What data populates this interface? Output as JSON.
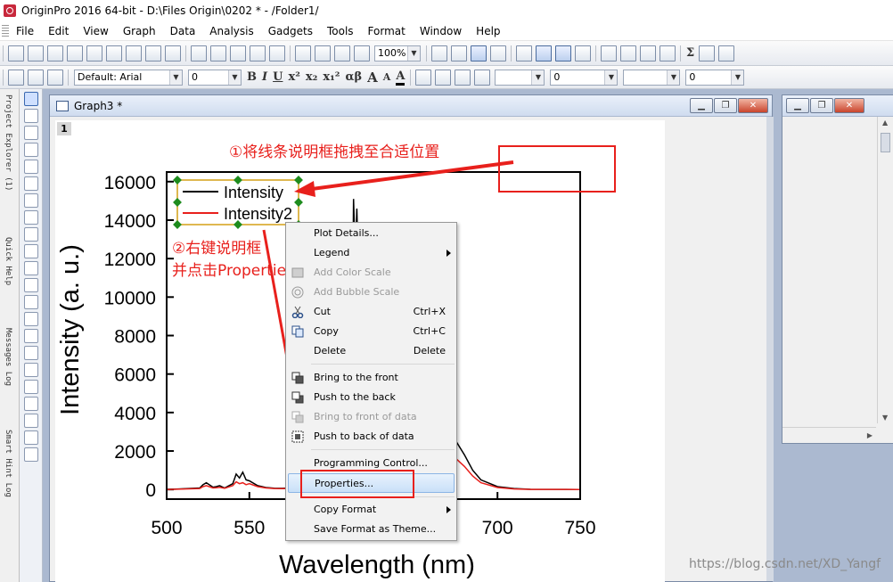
{
  "app": {
    "title": "OriginPro 2016 64-bit - D:\\Files Origin\\0202 * - /Folder1/"
  },
  "menu": {
    "items": [
      "File",
      "Edit",
      "View",
      "Graph",
      "Data",
      "Analysis",
      "Gadgets",
      "Tools",
      "Format",
      "Window",
      "Help"
    ]
  },
  "toolbar": {
    "zoom_value": "100%",
    "font_name": "Default: Arial",
    "font_size": "0",
    "line_width": "0",
    "fill_value": "0",
    "bold_label": "B",
    "italic_label": "I",
    "underline_label": "U",
    "superscript_label": "x²",
    "subscript_label": "x₂",
    "supsub_label": "x₁²",
    "greek_label": "αβ",
    "increase_font_label": "A",
    "decrease_font_label": "A",
    "font_color_label": "A",
    "sum_label": "Σ",
    "grip_label": "⋮"
  },
  "sidebar": {
    "tabs": [
      "Project Explorer (1)",
      "Quick Help",
      "Messages Log",
      "Smart Hint Log"
    ]
  },
  "graph_window": {
    "title": "Graph3 *",
    "layer_number": "1"
  },
  "chart_data": {
    "type": "line",
    "xlabel": "Wavelength (nm)",
    "ylabel": "Intensity (a. u.)",
    "xlim": [
      500,
      750
    ],
    "ylim": [
      -500,
      16500
    ],
    "xticks": [
      "500",
      "550",
      "600",
      "650",
      "700",
      "750"
    ],
    "yticks": [
      "0",
      "2000",
      "4000",
      "6000",
      "8000",
      "10000",
      "12000",
      "14000",
      "16000"
    ],
    "legend": [
      "Intensity",
      "Intensity2"
    ],
    "legend_position": "top-left",
    "series": [
      {
        "name": "Intensity",
        "color": "#000000",
        "x": [
          500,
          520,
          522,
          524,
          528,
          530,
          532,
          535,
          540,
          542,
          544,
          546,
          548,
          550,
          555,
          560,
          565,
          570,
          575,
          580,
          585,
          590,
          595,
          600,
          605,
          610,
          612,
          613,
          614,
          615,
          616,
          617,
          618,
          620,
          625,
          630,
          635,
          640,
          645,
          650,
          655,
          660,
          665,
          670,
          675,
          680,
          685,
          690,
          700,
          710,
          720,
          750
        ],
        "y": [
          0,
          80,
          250,
          350,
          120,
          150,
          200,
          80,
          300,
          800,
          600,
          900,
          500,
          450,
          200,
          100,
          70,
          60,
          80,
          100,
          150,
          250,
          400,
          650,
          1200,
          3000,
          6000,
          15100,
          12000,
          14600,
          11000,
          9000,
          7000,
          5000,
          3500,
          3000,
          3200,
          3000,
          2800,
          3200,
          3500,
          4000,
          3500,
          3000,
          2500,
          1800,
          1000,
          500,
          150,
          50,
          10,
          0
        ]
      },
      {
        "name": "Intensity2",
        "color": "#e8201c",
        "x": [
          500,
          520,
          522,
          524,
          528,
          530,
          532,
          535,
          540,
          542,
          544,
          546,
          548,
          550,
          555,
          560,
          565,
          570,
          575,
          580,
          585,
          590,
          595,
          600,
          605,
          610,
          612,
          613,
          614,
          615,
          616,
          617,
          618,
          620,
          625,
          630,
          635,
          640,
          645,
          650,
          655,
          660,
          665,
          670,
          675,
          680,
          685,
          690,
          700,
          710,
          720,
          750
        ],
        "y": [
          0,
          50,
          150,
          200,
          80,
          90,
          110,
          60,
          200,
          400,
          300,
          350,
          250,
          300,
          150,
          80,
          50,
          45,
          55,
          70,
          100,
          160,
          250,
          400,
          700,
          1800,
          3600,
          4500,
          4200,
          4400,
          3900,
          3700,
          3200,
          2800,
          2200,
          2000,
          2100,
          2050,
          2000,
          2200,
          2400,
          2600,
          2300,
          2000,
          1600,
          1200,
          700,
          350,
          100,
          30,
          5,
          0
        ]
      }
    ]
  },
  "annotations": {
    "step1": "①将线条说明框拖拽至合适位置",
    "step2_line1": "②右键说明框",
    "step2_line2": "并点击Properties"
  },
  "context_menu": {
    "items": [
      {
        "label": "Plot Details...",
        "shortcut": "",
        "disabled": false,
        "submenu": false,
        "icon": ""
      },
      {
        "label": "Legend",
        "shortcut": "",
        "disabled": false,
        "submenu": true,
        "icon": ""
      },
      {
        "label": "Add Color Scale",
        "shortcut": "",
        "disabled": true,
        "submenu": false,
        "icon": "color-scale-icon"
      },
      {
        "label": "Add Bubble Scale",
        "shortcut": "",
        "disabled": true,
        "submenu": false,
        "icon": "bubble-scale-icon"
      },
      {
        "label": "Cut",
        "shortcut": "Ctrl+X",
        "disabled": false,
        "submenu": false,
        "icon": "scissors-icon"
      },
      {
        "label": "Copy",
        "shortcut": "Ctrl+C",
        "disabled": false,
        "submenu": false,
        "icon": "copy-icon"
      },
      {
        "label": "Delete",
        "shortcut": "Delete",
        "disabled": false,
        "submenu": false,
        "icon": ""
      },
      {
        "label": "Bring to the front",
        "shortcut": "",
        "disabled": false,
        "submenu": false,
        "icon": "bring-front-icon"
      },
      {
        "label": "Push to the back",
        "shortcut": "",
        "disabled": false,
        "submenu": false,
        "icon": "push-back-icon"
      },
      {
        "label": "Bring to front of data",
        "shortcut": "",
        "disabled": true,
        "submenu": false,
        "icon": "bring-front-data-icon"
      },
      {
        "label": "Push to back of data",
        "shortcut": "",
        "disabled": false,
        "submenu": false,
        "icon": "push-back-data-icon"
      },
      {
        "label": "Programming Control...",
        "shortcut": "",
        "disabled": false,
        "submenu": false,
        "icon": ""
      },
      {
        "label": "Properties...",
        "shortcut": "",
        "disabled": false,
        "submenu": false,
        "icon": "",
        "highlighted": true
      },
      {
        "label": "Copy Format",
        "shortcut": "",
        "disabled": false,
        "submenu": true,
        "icon": ""
      },
      {
        "label": "Save Format as Theme...",
        "shortcut": "",
        "disabled": false,
        "submenu": false,
        "icon": ""
      }
    ]
  },
  "watermark": "https://blog.csdn.net/XD_Yangf",
  "colors": {
    "annotation_red": "#e8201c",
    "legend_handle_green": "#1e8c1e",
    "legend_frame": "#d4a017",
    "highlight_blue": "#c9e0f8"
  }
}
